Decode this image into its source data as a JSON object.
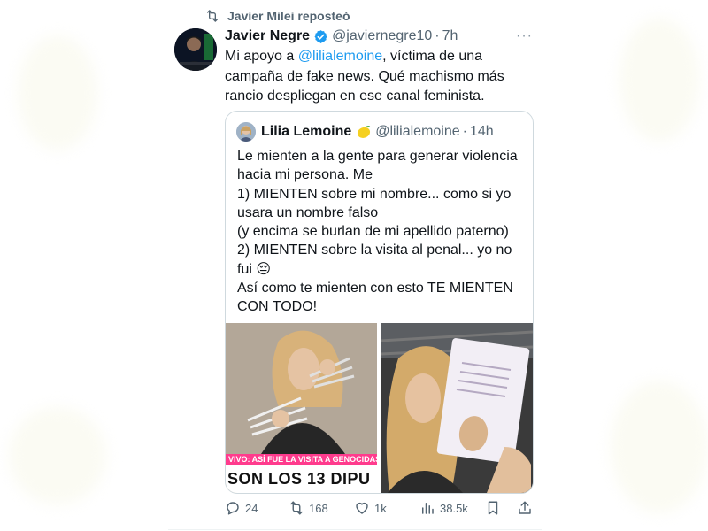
{
  "repost": {
    "label": "Javier Milei reposteó"
  },
  "tweet": {
    "author_name": "Javier Negre",
    "handle": "@javiernegre10",
    "separator": "·",
    "time": "7h",
    "more": "···",
    "text_prefix": "Mi apoyo a ",
    "mention": "@lilialemoine",
    "text_suffix": ", víctima de una campaña de fake news. Qué machismo más rancio despliegan en ese canal feminista."
  },
  "quote": {
    "author_name": "Lilia Lemoine",
    "handle": "@lilialemoine",
    "separator": "·",
    "time": "14h",
    "text": "Le mienten a la gente para generar violencia hacia mi persona. Me\n1) MIENTEN sobre mi nombre... como si yo usara un nombre falso\n(y encima se burlan de mi apellido paterno)\n2) MIENTEN sobre la visita al penal... yo no fui 😔\nAsí como te mienten con esto TE MIENTEN CON TODO!",
    "media": {
      "left_banner_top": "VIVO: ASÍ FUE LA VISITA A GENOCIDAS",
      "left_banner_bottom": "SON LOS 13 DIPU"
    }
  },
  "actions": {
    "replies": "24",
    "reposts": "168",
    "likes": "1k",
    "views": "38.5k"
  },
  "icons": [
    "repost-icon",
    "verified-icon",
    "more-icon",
    "lemon-icon",
    "reply-icon",
    "like-icon",
    "views-icon",
    "bookmark-icon",
    "share-icon"
  ],
  "colors": {
    "link": "#1d9bf0",
    "secondary": "#536471",
    "verified": "#1d9bf0",
    "border": "#cfd9de",
    "banner": "#ff3b8d"
  }
}
